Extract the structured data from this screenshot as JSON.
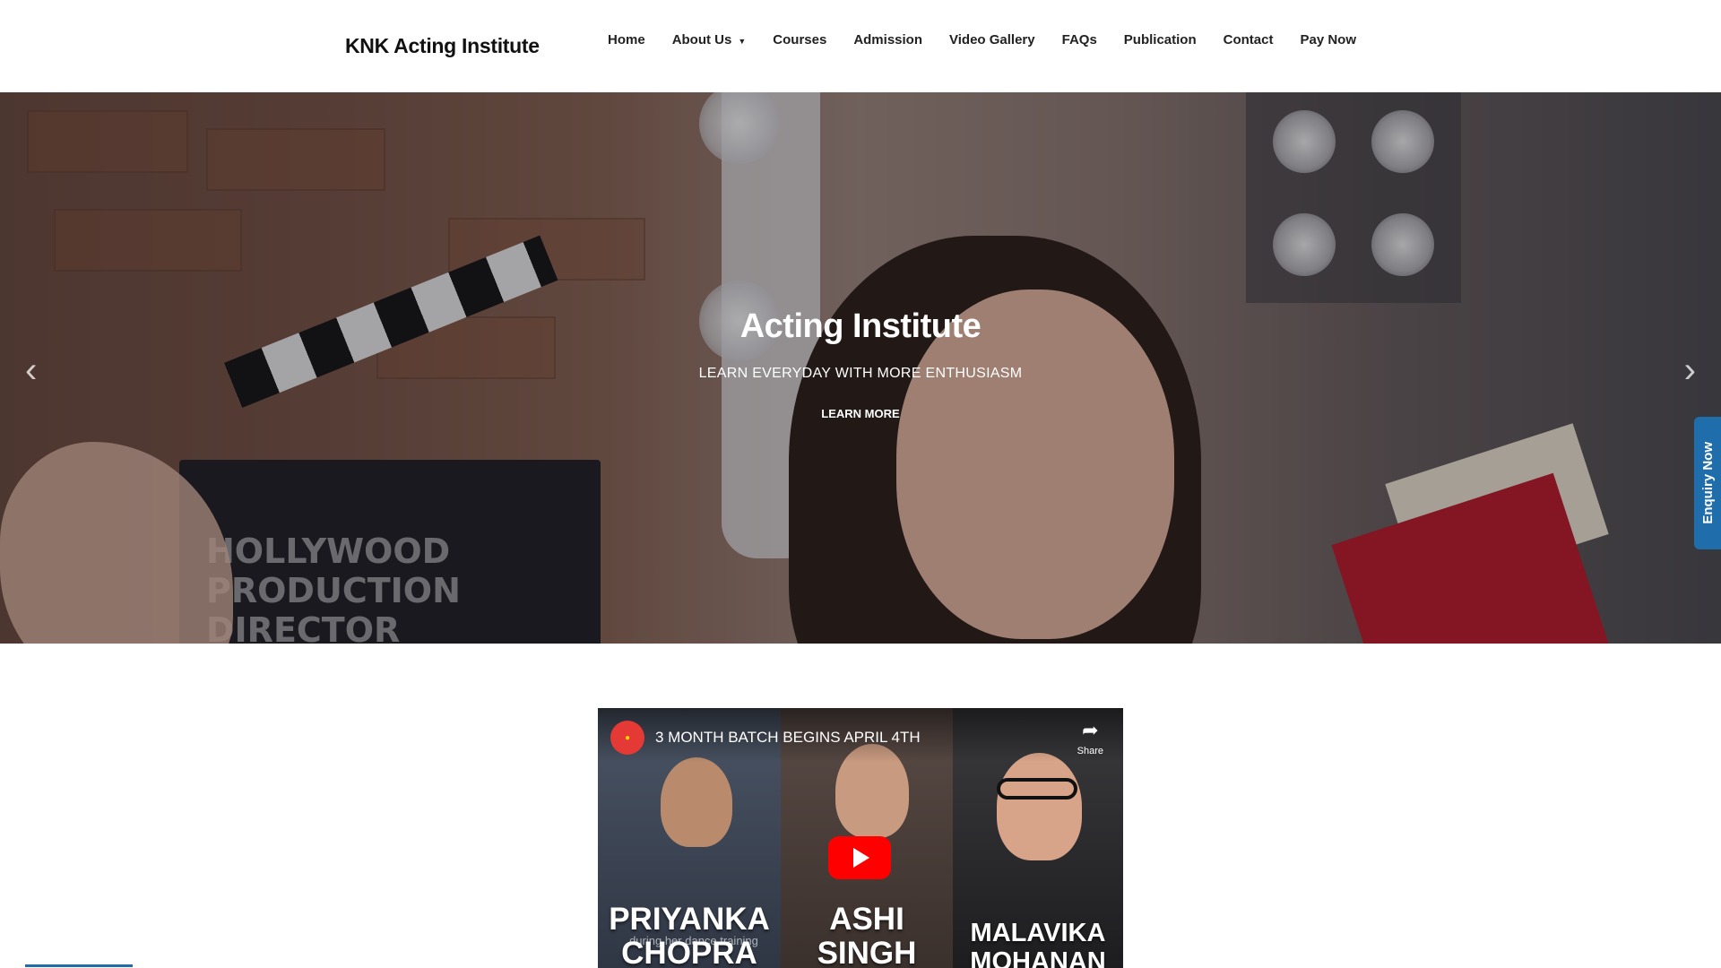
{
  "brand": {
    "name": "KNK Acting Institute"
  },
  "nav": {
    "items": [
      {
        "label": "Home"
      },
      {
        "label": "About Us"
      },
      {
        "label": "Courses"
      },
      {
        "label": "Admission"
      },
      {
        "label": "Video Gallery"
      },
      {
        "label": "FAQs"
      },
      {
        "label": "Publication"
      },
      {
        "label": "Contact"
      },
      {
        "label": "Pay Now"
      }
    ]
  },
  "hero": {
    "title": "Acting Institute",
    "subtitle": "LEARN EVERYDAY WITH MORE ENTHUSIASM",
    "cta_label": "LEARN MORE",
    "clapper_lines": [
      "HOLLYWOOD",
      "PRODUCTION",
      "DIRECTOR"
    ]
  },
  "enquiry": {
    "label": "Enquiry Now"
  },
  "video": {
    "title": "3 MONTH BATCH BEGINS APRIL 4TH",
    "share_label": "Share",
    "names": [
      "PRIYANKA CHOPRA",
      "ASHI SINGH",
      "MALAVIKA MOHANAN"
    ],
    "small_caption": "during her dance training"
  },
  "icons": {
    "prev": "chevron-left-icon",
    "next": "chevron-right-icon",
    "play": "play-icon",
    "share": "share-icon",
    "dropdown": "chevron-down-icon"
  },
  "colors": {
    "accent": "#1f6dab",
    "youtube_red": "#ff0000"
  }
}
